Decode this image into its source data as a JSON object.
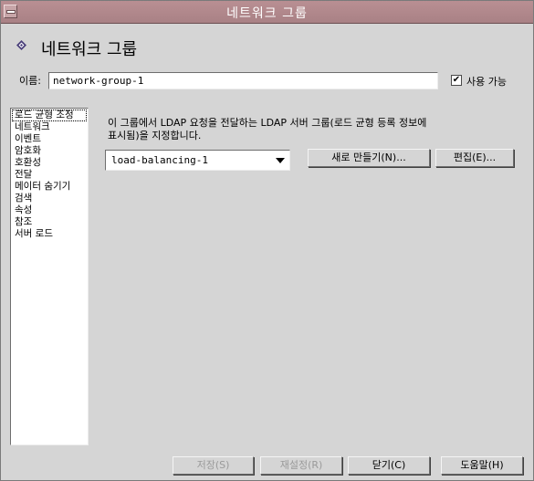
{
  "window": {
    "title": "네트워크 그룹"
  },
  "header": {
    "title": "네트워크 그룹"
  },
  "name_field": {
    "label": "이름:",
    "value": "network-group-1"
  },
  "enabled": {
    "label": "사용 가능",
    "checked": true,
    "mark": "✔"
  },
  "sidebar": {
    "items": [
      {
        "label": "로드 균형 조정",
        "selected": true
      },
      {
        "label": "네트워크"
      },
      {
        "label": "이벤트"
      },
      {
        "label": "암호화"
      },
      {
        "label": "호환성"
      },
      {
        "label": "전달"
      },
      {
        "label": "메이터 숨기기"
      },
      {
        "label": "검색"
      },
      {
        "label": "속성"
      },
      {
        "label": "참조"
      },
      {
        "label": "서버 로드"
      }
    ]
  },
  "main": {
    "description_line1": "이 그룹에서 LDAP 요청을 전달하는 LDAP 서버 그룹(로드 균형 등록 정보에",
    "description_line2": "표시됨)을 지정합니다.",
    "lb_select_value": "load-balancing-1",
    "new_button": "새로 만들기(N)...",
    "edit_button": "편집(E)..."
  },
  "footer": {
    "save": "저장(S)",
    "reset": "재설정(R)",
    "close": "닫기(C)",
    "help": "도움말(H)"
  },
  "colors": {
    "titlebar": "#a98185",
    "background": "#d5d5d5",
    "header_icon": "#4a3f7a"
  }
}
